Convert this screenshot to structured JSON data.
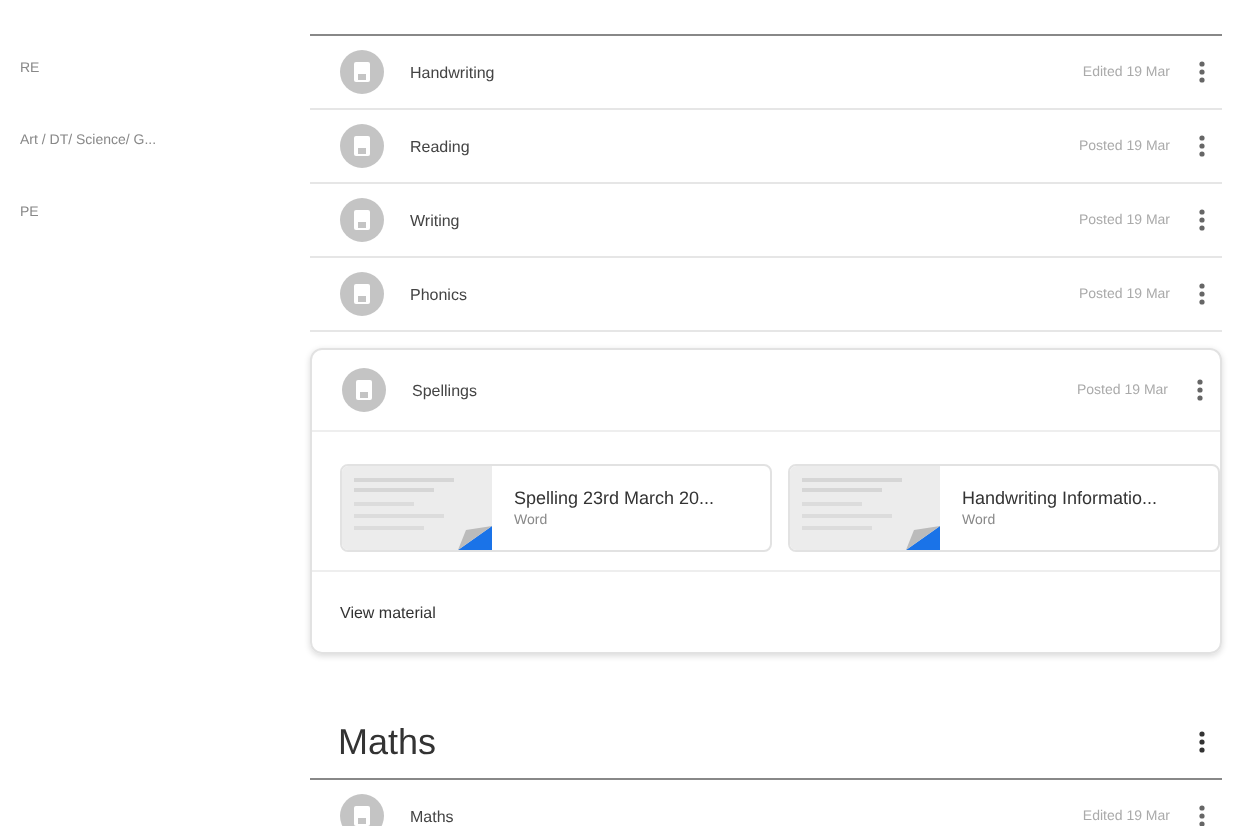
{
  "sidebar": {
    "items": [
      {
        "label": "RE"
      },
      {
        "label": "Art / DT/ Science/ G..."
      },
      {
        "label": "PE"
      }
    ]
  },
  "sections": [
    {
      "posts": [
        {
          "kind": "post",
          "title": "Handwriting",
          "date": "Edited 19 Mar"
        },
        {
          "kind": "post",
          "title": "Reading",
          "date": "Posted 19 Mar"
        },
        {
          "kind": "post",
          "title": "Writing",
          "date": "Posted 19 Mar"
        },
        {
          "kind": "post",
          "title": "Phonics",
          "date": "Posted 19 Mar"
        },
        {
          "kind": "expanded",
          "title": "Spellings",
          "date": "Posted 19 Mar",
          "attachments": [
            {
              "name": "Spelling 23rd March 20...",
              "type": "Word"
            },
            {
              "name": "Handwriting Informatio...",
              "type": "Word"
            }
          ],
          "link": "View material"
        }
      ]
    },
    {
      "heading": "Maths",
      "posts": [
        {
          "kind": "post",
          "title": "Maths",
          "date": "Edited 19 Mar"
        }
      ]
    }
  ]
}
